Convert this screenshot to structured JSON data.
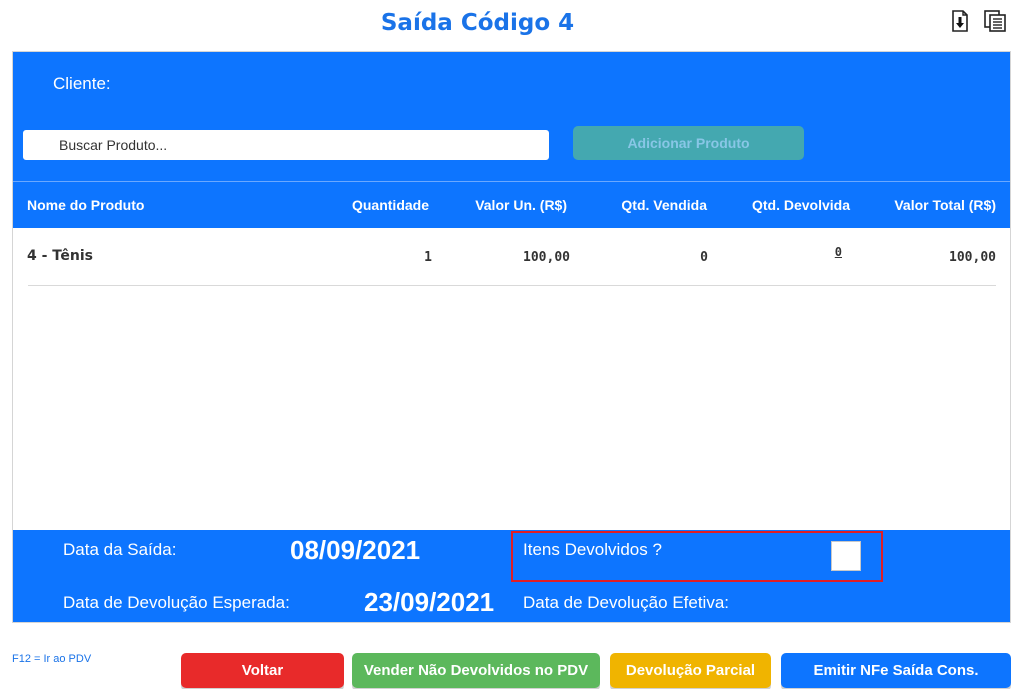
{
  "header": {
    "title": "Saída Código 4"
  },
  "panel": {
    "cliente_label": "Cliente:",
    "search_placeholder": "Buscar Produto...",
    "add_button_label": "Adicionar Produto"
  },
  "table": {
    "columns": [
      "Nome do Produto",
      "Quantidade",
      "Valor Un. (R$)",
      "Qtd. Vendida",
      "Qtd. Devolvida",
      "Valor Total (R$)"
    ],
    "rows": [
      {
        "nome": "4 - Tênis",
        "quantidade": "1",
        "valor_un": "100,00",
        "qtd_vendida": "0",
        "qtd_devolvida": "0",
        "valor_total": "100,00"
      }
    ]
  },
  "footer": {
    "data_saida_label": "Data da Saída:",
    "data_saida_value": "08/09/2021",
    "itens_devolvidos_label": "Itens Devolvidos ?",
    "itens_devolvidos_checked": false,
    "data_devolucao_esperada_label": "Data de Devolução Esperada:",
    "data_devolucao_esperada_value": "23/09/2021",
    "data_devolucao_efetiva_label": "Data de Devolução Efetiva:"
  },
  "shortcut_hint": "F12 = Ir ao PDV",
  "actions": {
    "voltar_label": "Voltar",
    "vender_label": "Vender Não Devolvidos no PDV",
    "parcial_label": "Devolução Parcial",
    "emitir_label": "Emitir NFe Saída Cons."
  },
  "colors": {
    "primary_blue": "#0d75ff",
    "title_blue": "#1a73e8",
    "danger_red": "#e82a2a",
    "success_green": "#5cb85c",
    "warning_yellow": "#f0b400",
    "disabled_teal": "#44a8b0",
    "highlight_red": "#e01e25"
  },
  "icons": [
    "download-icon",
    "copy-icon"
  ]
}
